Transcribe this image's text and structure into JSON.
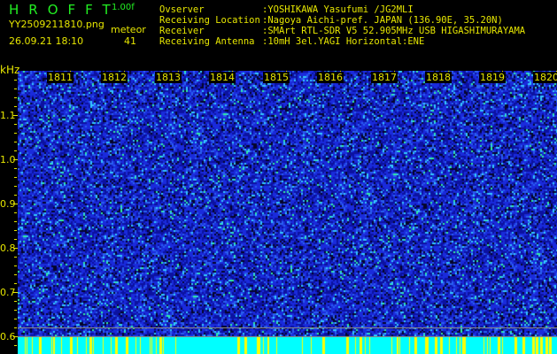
{
  "header": {
    "app_title": "HROFFT",
    "version": "1.00f",
    "filename": "YY2509211810.png",
    "datetime": "26.09.21 18:10",
    "meteor_label": "meteor",
    "meteor_count": "41",
    "info": [
      {
        "label": "Ovserver",
        "value": ":YOSHIKAWA Yasufumi /JG2MLI"
      },
      {
        "label": "Receiving Location",
        "value": ":Nagoya Aichi-pref. JAPAN (136.90E, 35.20N)"
      },
      {
        "label": "Receiver",
        "value": ":SMArt RTL-SDR V5 52.905MHz USB HIGASHIMURAYAMA"
      },
      {
        "label": "Receiving Antenna",
        "value": ":10mH 3el.YAGI Horizontal:ENE"
      }
    ]
  },
  "chart_data": {
    "type": "heatmap",
    "ylabel": "kHz",
    "x_ticks": [
      "1811",
      "1812",
      "1813",
      "1814",
      "1815",
      "1816",
      "1817",
      "1818",
      "1819",
      "1820"
    ],
    "y_ticks": [
      "1.1",
      "1.0",
      "0.9",
      "0.8",
      "0.7",
      "0.6"
    ],
    "ylim": [
      0.58,
      1.2
    ],
    "colors": {
      "background": "#0a0a60",
      "noise": "#1a2bdc",
      "hot": "#33e0ff",
      "baseline": "#00ffff",
      "meteor_marker": "#ffff00"
    }
  }
}
